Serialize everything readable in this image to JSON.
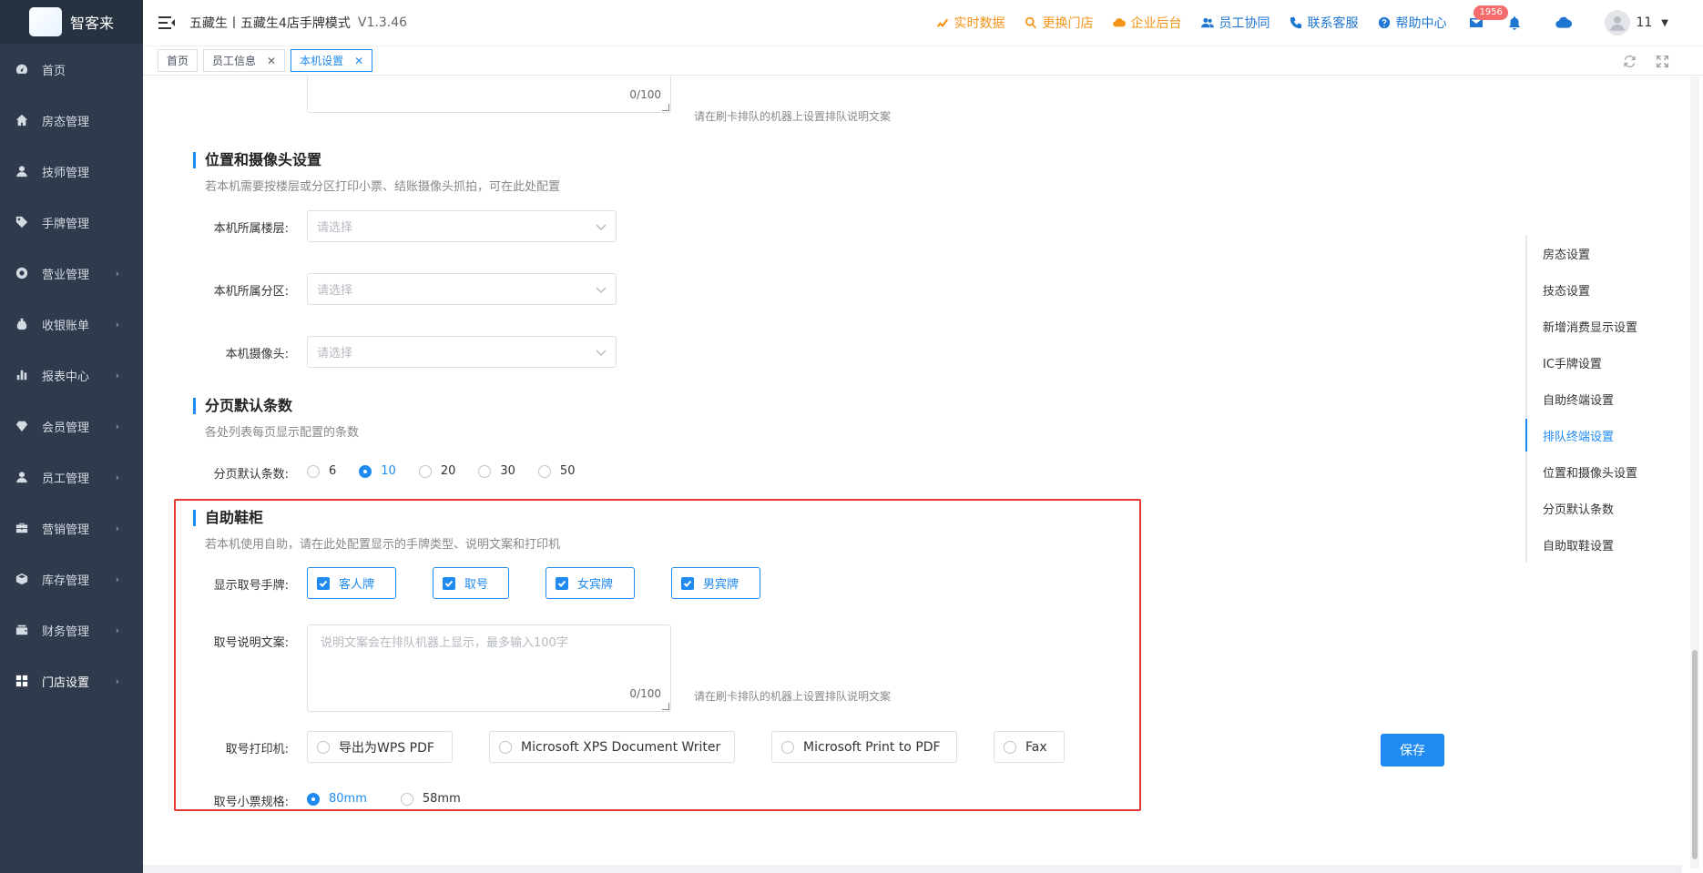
{
  "app": {
    "logo_text": "智客来",
    "logo_mark": "智客来"
  },
  "sidebar": {
    "items": [
      {
        "label": "首页",
        "icon": "dashboard-icon",
        "arrow": ""
      },
      {
        "label": "房态管理",
        "icon": "home-icon",
        "arrow": ""
      },
      {
        "label": "技师管理",
        "icon": "user-icon",
        "arrow": ""
      },
      {
        "label": "手牌管理",
        "icon": "tag-icon",
        "arrow": ""
      },
      {
        "label": "营业管理",
        "icon": "circle-gear-icon",
        "arrow": "›"
      },
      {
        "label": "收银账单",
        "icon": "wallet-icon",
        "arrow": "›"
      },
      {
        "label": "报表中心",
        "icon": "bar-chart-icon",
        "arrow": "›"
      },
      {
        "label": "会员管理",
        "icon": "diamond-icon",
        "arrow": "›"
      },
      {
        "label": "员工管理",
        "icon": "user-icon",
        "arrow": "›"
      },
      {
        "label": "营销管理",
        "icon": "briefcase-icon",
        "arrow": "›"
      },
      {
        "label": "库存管理",
        "icon": "box-icon",
        "arrow": "›"
      },
      {
        "label": "财务管理",
        "icon": "finance-icon",
        "arrow": "›"
      },
      {
        "label": "门店设置",
        "icon": "grid-icon",
        "arrow": "›"
      }
    ]
  },
  "header": {
    "title": "五藏生丨五藏生4店手牌模式",
    "version": "V1.3.46",
    "links": [
      {
        "label": "实时数据",
        "icon": "trend-icon",
        "color": "#f39317"
      },
      {
        "label": "更换门店",
        "icon": "search-icon",
        "color": "#f39317"
      },
      {
        "label": "企业后台",
        "icon": "cloud-icon",
        "color": "#f39317"
      },
      {
        "label": "员工协同",
        "icon": "users-icon",
        "color": "#1f76d2"
      },
      {
        "label": "联系客服",
        "icon": "phone-icon",
        "color": "#1f76d2"
      },
      {
        "label": "帮助中心",
        "icon": "help-icon",
        "color": "#1f76d2"
      }
    ],
    "mail_badge": "1956",
    "user_name": "11"
  },
  "tabs": [
    {
      "label": "首页",
      "closable": false,
      "active": false
    },
    {
      "label": "员工信息",
      "closable": true,
      "active": false
    },
    {
      "label": "本机设置",
      "closable": true,
      "active": true
    }
  ],
  "content": {
    "top_textarea": {
      "count": "0/100",
      "hint": "请在刷卡排队的机器上设置排队说明文案"
    },
    "position_section": {
      "title": "位置和摄像头设置",
      "desc": "若本机需要按楼层或分区打印小票、结账摄像头抓拍，可在此处配置",
      "floor_label": "本机所属楼层:",
      "zone_label": "本机所属分区:",
      "camera_label": "本机摄像头:",
      "placeholder": "请选择"
    },
    "pagination_section": {
      "title": "分页默认条数",
      "desc": "各处列表每页显示配置的条数",
      "label": "分页默认条数:",
      "options": [
        "6",
        "10",
        "20",
        "30",
        "50"
      ],
      "selected": "10"
    },
    "shoe_section": {
      "title": "自助鞋柜",
      "desc": "若本机使用自助，请在此处配置显示的手牌类型、说明文案和打印机",
      "display_label": "显示取号手牌:",
      "checkboxes": [
        "客人牌",
        "取号",
        "女宾牌",
        "男宾牌"
      ],
      "text_label": "取号说明文案:",
      "text_placeholder": "说明文案会在排队机器上显示，最多输入100字",
      "text_count": "0/100",
      "text_hint": "请在刷卡排队的机器上设置排队说明文案",
      "printer_label": "取号打印机:",
      "printers": [
        "导出为WPS PDF",
        "Microsoft XPS Document Writer",
        "Microsoft Print to PDF",
        "Fax"
      ],
      "ticket_label": "取号小票规格:",
      "ticket_options": [
        "80mm",
        "58mm"
      ],
      "ticket_selected": "80mm"
    },
    "save_label": "保存"
  },
  "anchor_nav": {
    "items": [
      "房态设置",
      "技态设置",
      "新增消费显示设置",
      "IC手牌设置",
      "自助终端设置",
      "排队终端设置",
      "位置和摄像头设置",
      "分页默认条数",
      "自助取鞋设置"
    ],
    "active": "排队终端设置"
  },
  "colors": {
    "primary": "#1f8bf0",
    "orange": "#f39317",
    "sidebar_bg": "#2f3b4c",
    "highlight_border": "#e53935"
  }
}
